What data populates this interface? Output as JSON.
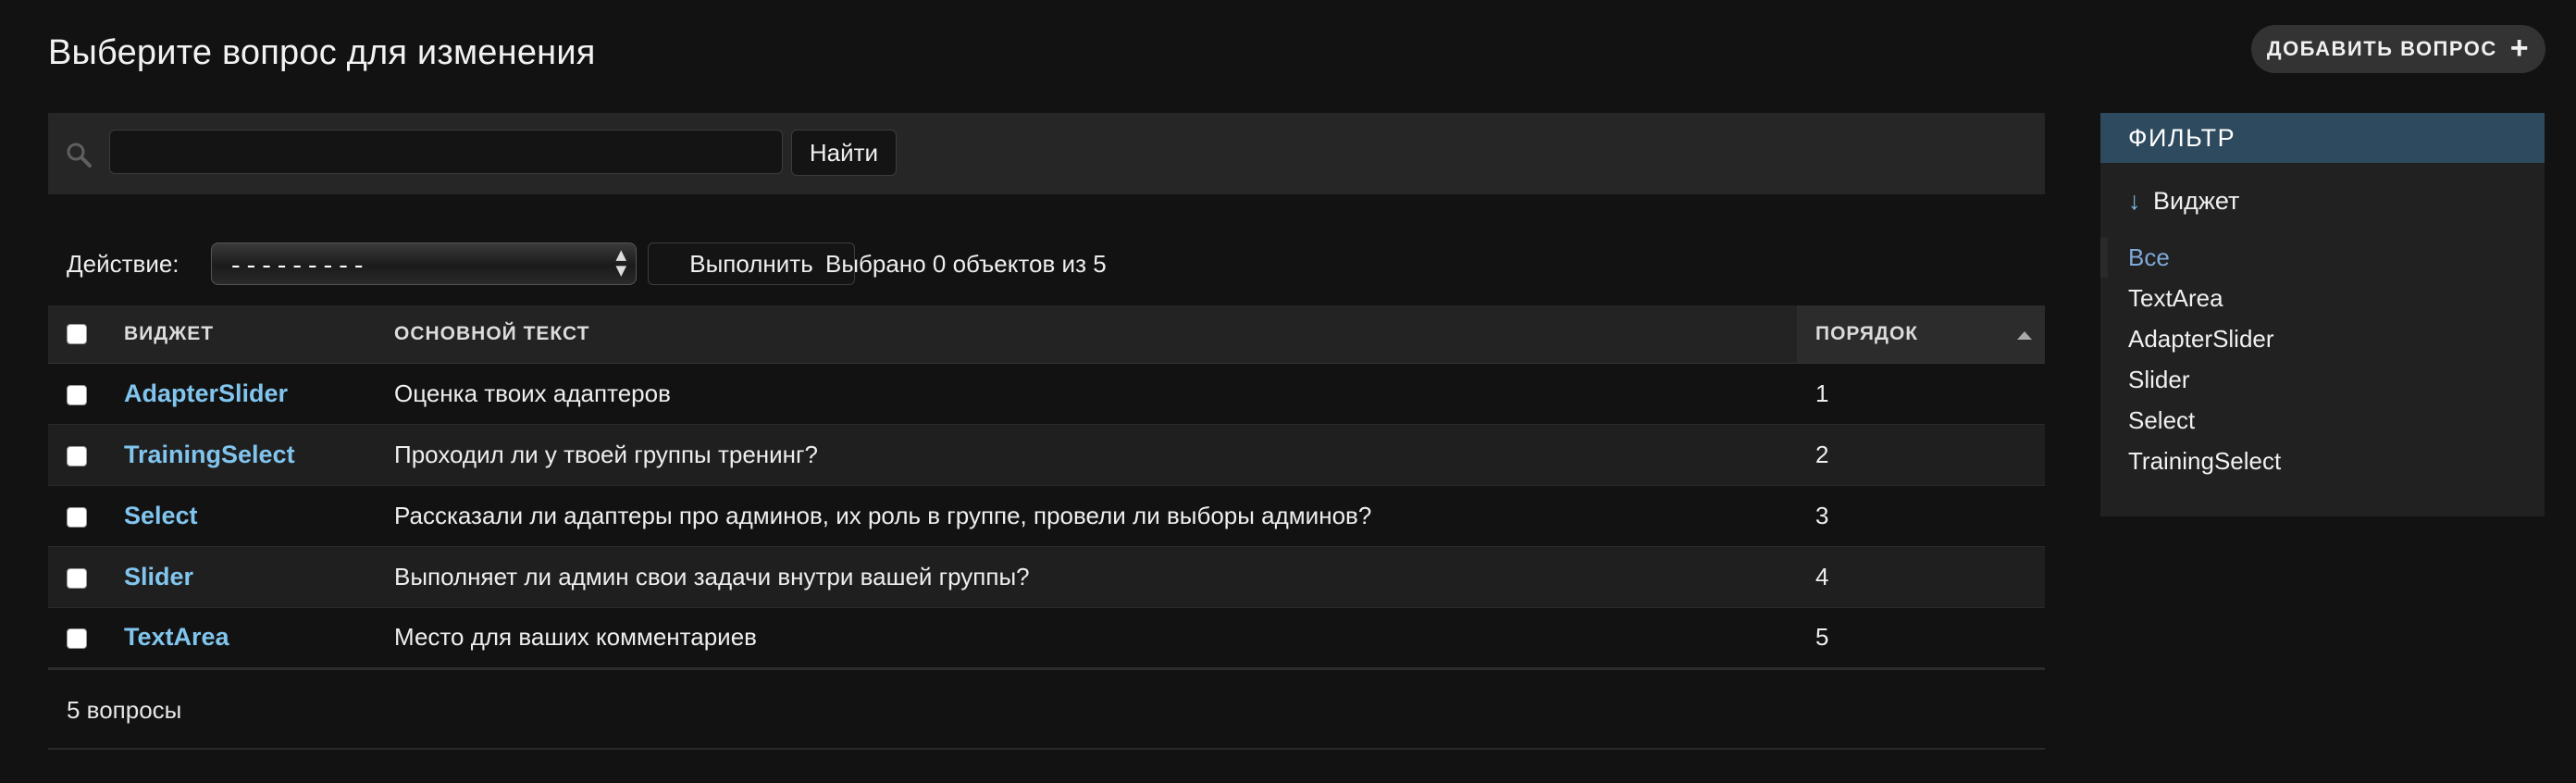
{
  "page_title": "Выберите вопрос для изменения",
  "add_button": {
    "label": "ДОБАВИТЬ ВОПРОС",
    "icon": "plus-icon"
  },
  "search": {
    "value": "",
    "placeholder": "",
    "button_label": "Найти",
    "icon": "search-icon"
  },
  "actions": {
    "label": "Действие:",
    "selected_action": "---------",
    "run_label": "Выполнить",
    "counter": "Выбрано 0 объектов из 5"
  },
  "table": {
    "headers": {
      "widget": "ВИДЖЕТ",
      "text": "ОСНОВНОЙ ТЕКСТ",
      "order": "ПОРЯДОК"
    },
    "rows": [
      {
        "widget": "AdapterSlider",
        "text": "Оценка твоих адаптеров",
        "order": "1"
      },
      {
        "widget": "TrainingSelect",
        "text": "Проходил ли у твоей группы тренинг?",
        "order": "2"
      },
      {
        "widget": "Select",
        "text": "Рассказали ли адаптеры про админов, их роль в группе, провели ли выборы админов?",
        "order": "3"
      },
      {
        "widget": "Slider",
        "text": "Выполняет ли админ свои задачи внутри вашей группы?",
        "order": "4"
      },
      {
        "widget": "TextArea",
        "text": "Место для ваших комментариев",
        "order": "5"
      }
    ]
  },
  "paginator": {
    "text": "5 вопросы"
  },
  "filter": {
    "title": "ФИЛЬТР",
    "section_title": "Виджет",
    "section_arrow": "↓",
    "items": [
      "Все",
      "TextArea",
      "AdapterSlider",
      "Slider",
      "Select",
      "TrainingSelect"
    ],
    "selected_item": "Все"
  },
  "colors": {
    "background": "#121212",
    "link": "#81c5ee",
    "filter_header": "#2e4a5e",
    "filter_selected": "#7fa9d8"
  }
}
